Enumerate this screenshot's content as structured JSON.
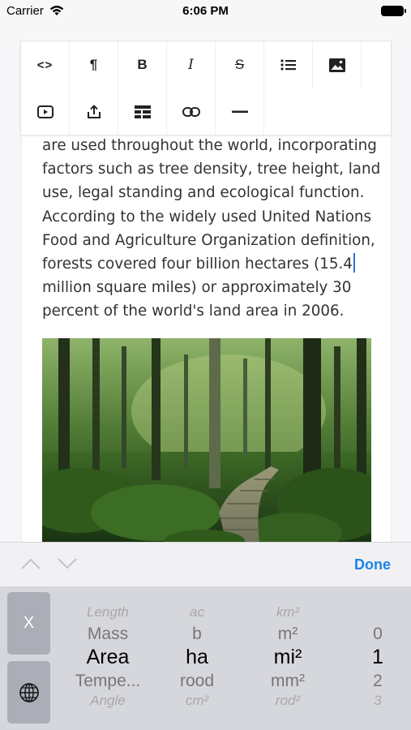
{
  "status_bar": {
    "carrier": "Carrier",
    "time": "6:06 PM"
  },
  "toolbar": {
    "buttons": [
      {
        "name": "code-icon",
        "glyph": "<>"
      },
      {
        "name": "paragraph-icon",
        "glyph": "¶"
      },
      {
        "name": "bold-icon",
        "glyph": "B"
      },
      {
        "name": "italic-icon",
        "glyph": "I"
      },
      {
        "name": "strikethrough-icon",
        "glyph": "S"
      },
      {
        "name": "list-icon",
        "glyph": ""
      },
      {
        "name": "image-icon",
        "glyph": ""
      },
      {
        "name": "video-icon",
        "glyph": ""
      },
      {
        "name": "share-icon",
        "glyph": ""
      },
      {
        "name": "table-icon",
        "glyph": ""
      },
      {
        "name": "link-icon",
        "glyph": ""
      },
      {
        "name": "horizontal-rule-icon",
        "glyph": ""
      }
    ]
  },
  "editor": {
    "lines": [
      "are used throughout the world, incorporating",
      "factors such as tree density, tree height, land",
      "use, legal standing and ecological function.",
      "According to the widely used United Nations",
      "Food and Agriculture Organization definition,",
      "forests covered four billion hectares (15.4",
      "million square miles) or approximately 30",
      "percent of the world's land area in 2006."
    ],
    "image_alt": "forest-boardwalk-photo"
  },
  "accessory": {
    "done_label": "Done"
  },
  "keyboard": {
    "close_label": "X"
  },
  "picker": {
    "columns": [
      [
        "Length",
        "Mass",
        "Area",
        "Tempe...",
        "Angle"
      ],
      [
        "ac",
        "b",
        "ha",
        "rood",
        "cm²"
      ],
      [
        "km²",
        "m²",
        "mi²",
        "mm²",
        "rod²"
      ],
      [
        "",
        "0",
        "1",
        "2",
        "3"
      ]
    ],
    "selected_index": 2
  },
  "colors": {
    "accent": "#1b84e6",
    "cursor": "#2f6fe0",
    "key_gray": "#abaeb6",
    "picker_bg": "#d6d7dc"
  }
}
